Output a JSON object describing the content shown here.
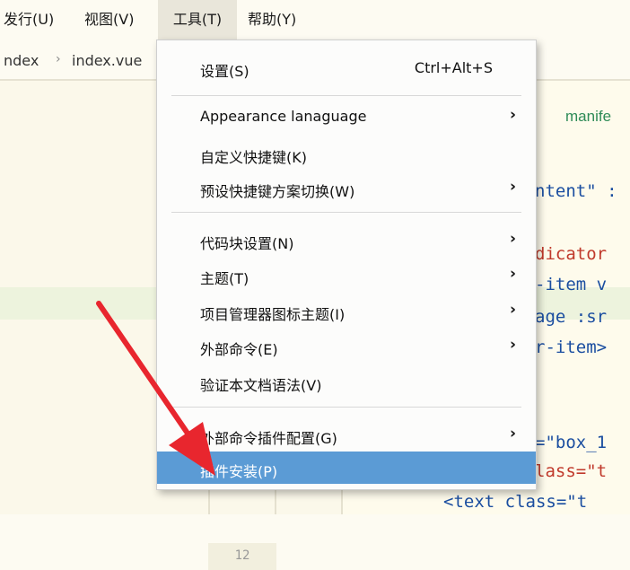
{
  "menubar": {
    "items": [
      {
        "label": "发行(U)"
      },
      {
        "label": "视图(V)"
      },
      {
        "label": "工具(T)"
      },
      {
        "label": "帮助(Y)"
      }
    ]
  },
  "breadcrumb": {
    "items": [
      "ndex",
      "index.vue"
    ],
    "separator": "›"
  },
  "editor": {
    "code_lines": [
      {
        "text": "manife"
      },
      {
        "text": "ntent\" :"
      },
      {
        "text": "dicator"
      },
      {
        "text": "-item v"
      },
      {
        "text": "age :sr"
      },
      {
        "text": "r-item>"
      },
      {
        "text": "=\"box_1"
      },
      {
        "text": "lass=\"t"
      },
      {
        "text": "<text class=\"t"
      }
    ],
    "line_number": "12"
  },
  "tools_menu": {
    "items": [
      {
        "label": "设置(S)",
        "shortcut": "Ctrl+Alt+S"
      },
      {
        "label": "Appearance lanaguage",
        "arrow": "›"
      },
      {
        "label": "自定义快捷键(K)"
      },
      {
        "label": "预设快捷键方案切换(W)",
        "arrow": "›"
      },
      {
        "label": "代码块设置(N)",
        "arrow": "›"
      },
      {
        "label": "主题(T)",
        "arrow": "›"
      },
      {
        "label": "项目管理器图标主题(I)",
        "arrow": "›"
      },
      {
        "label": "外部命令(E)",
        "arrow": "›"
      },
      {
        "label": "验证本文档语法(V)"
      },
      {
        "label": "外部命令插件配置(G)",
        "arrow": "›"
      },
      {
        "label": "插件安装(P)"
      }
    ]
  },
  "colors": {
    "highlight": "#5b9bd5",
    "annotation_arrow": "#e8262e"
  }
}
